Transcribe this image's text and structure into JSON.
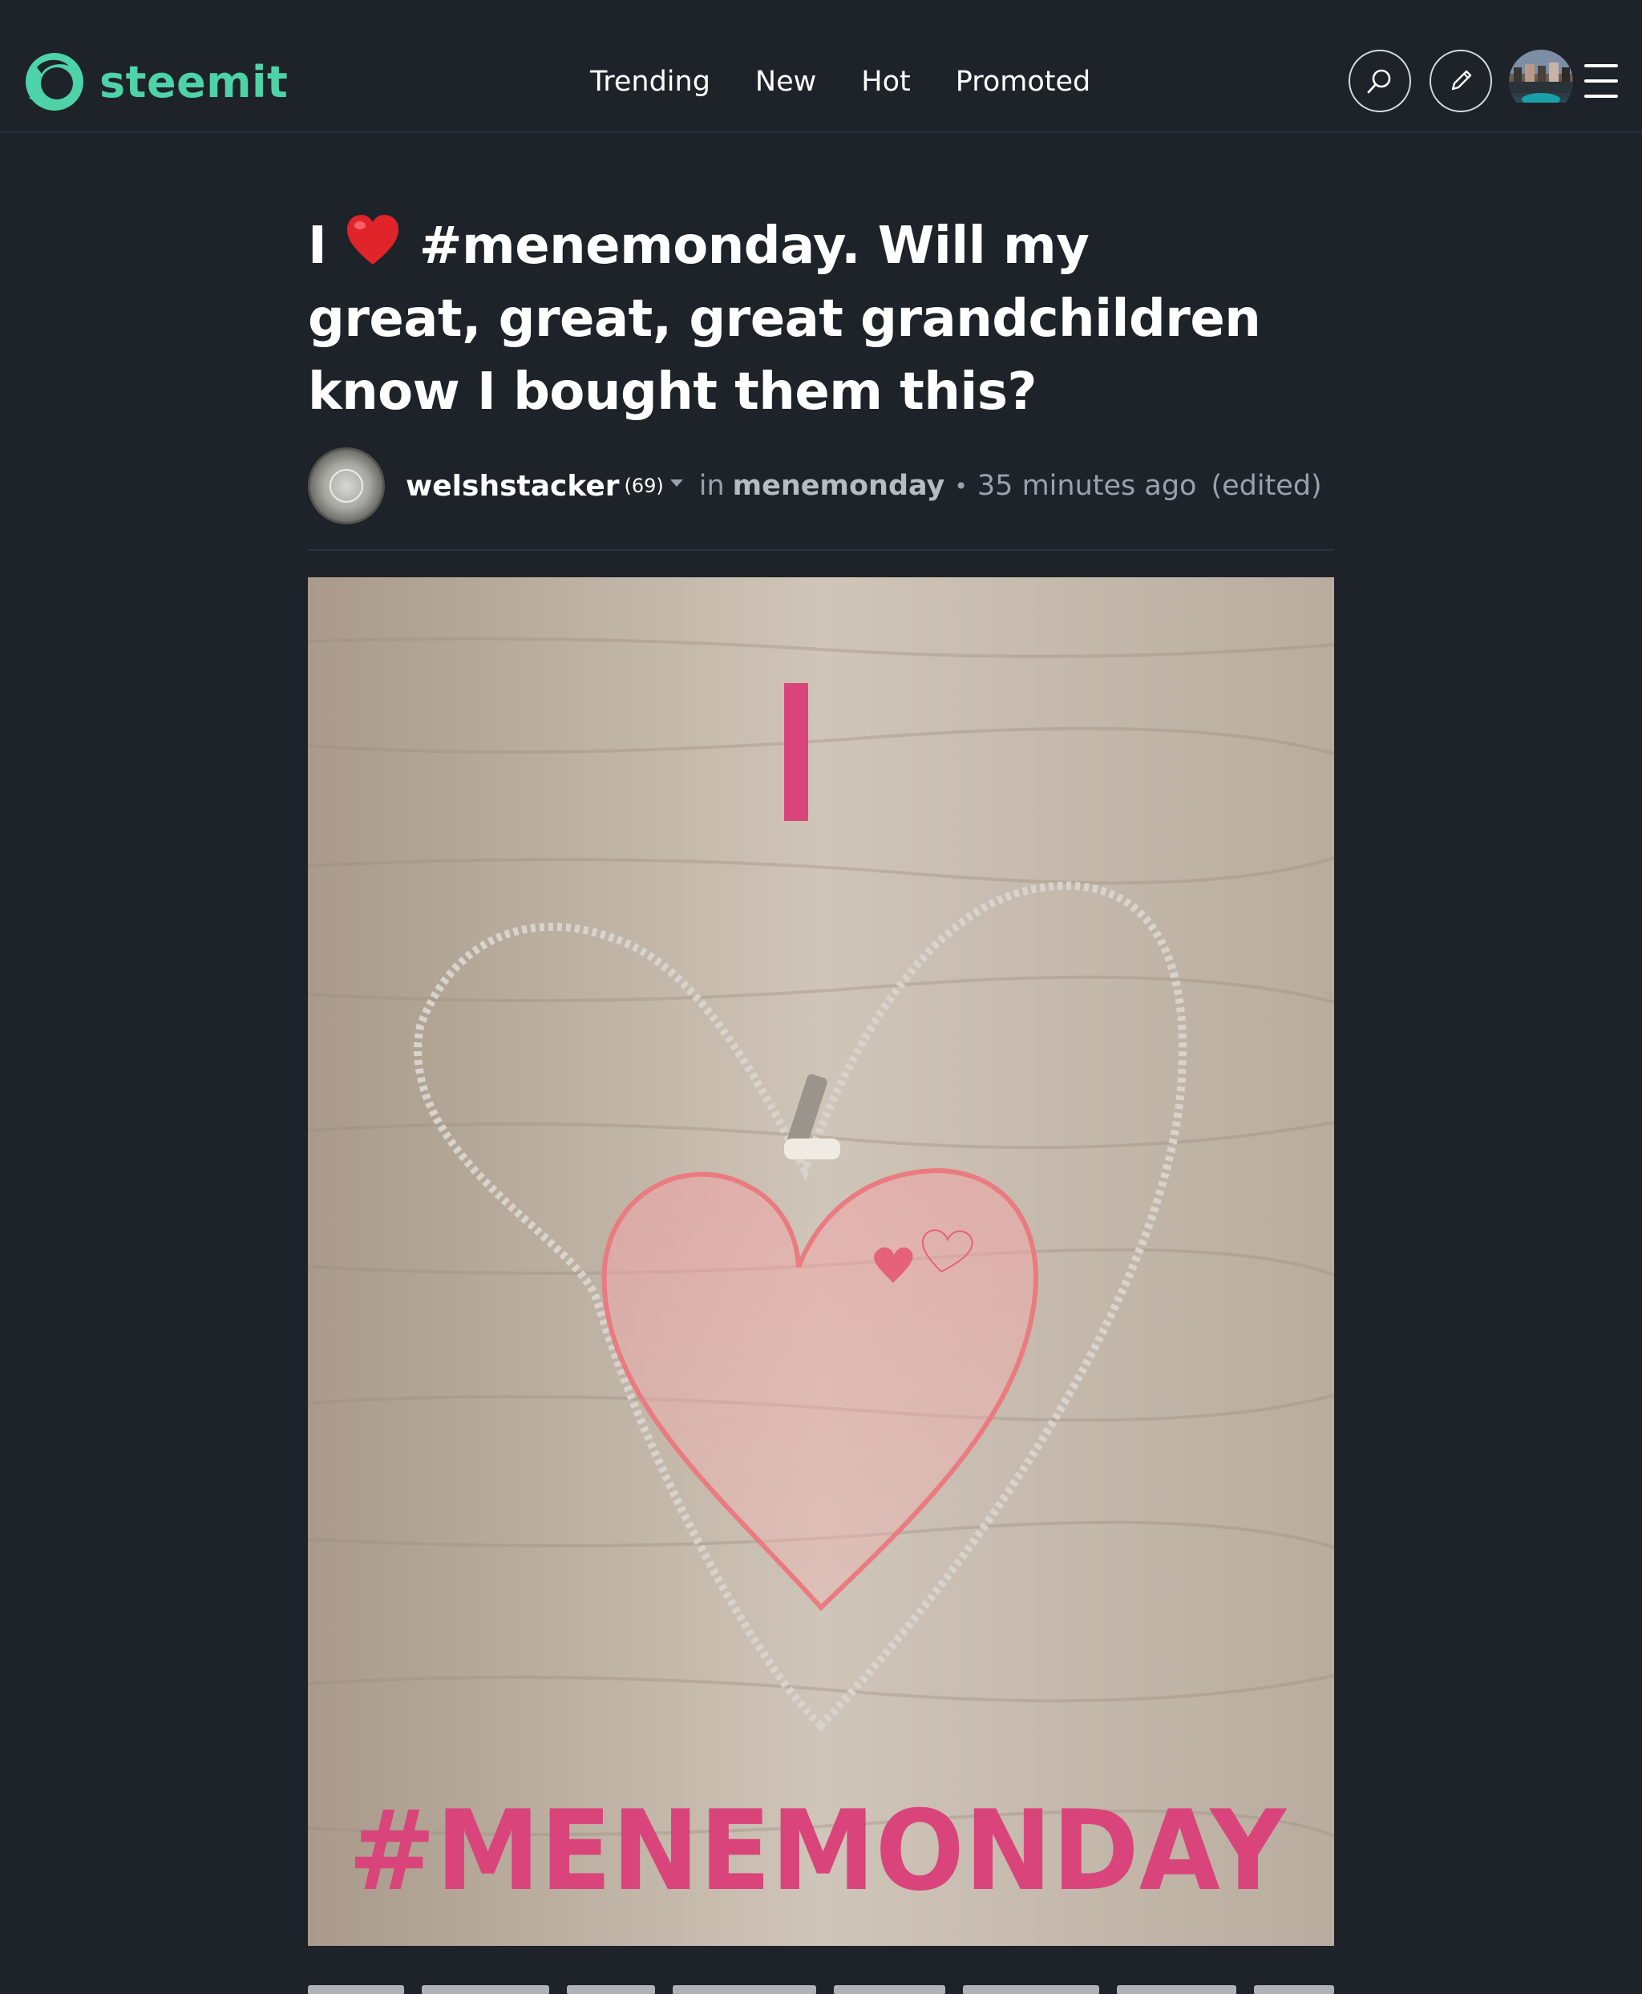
{
  "header": {
    "brand": "steemit",
    "brand_color": "#4ed2a7",
    "nav": [
      {
        "label": "Trending"
      },
      {
        "label": "New"
      },
      {
        "label": "Hot"
      },
      {
        "label": "Promoted"
      }
    ],
    "icons": [
      "search-icon",
      "pencil-icon",
      "avatar",
      "hamburger-icon"
    ]
  },
  "post": {
    "title_prefix": "I",
    "title_rest": "#menemonday. Will my great, great, great grandchildren know I bought them this?",
    "title_emoji": "red-heart-emoji",
    "author": "welshstacker",
    "reputation": "(69)",
    "in_label": "in",
    "category": "menemonday",
    "separator": "•",
    "time_ago": "35 minutes ago",
    "edited": "(edited)",
    "image": {
      "caption_top": "I",
      "caption_bottom": "#MENEMONDAY",
      "accent_color": "#d9457a"
    }
  }
}
